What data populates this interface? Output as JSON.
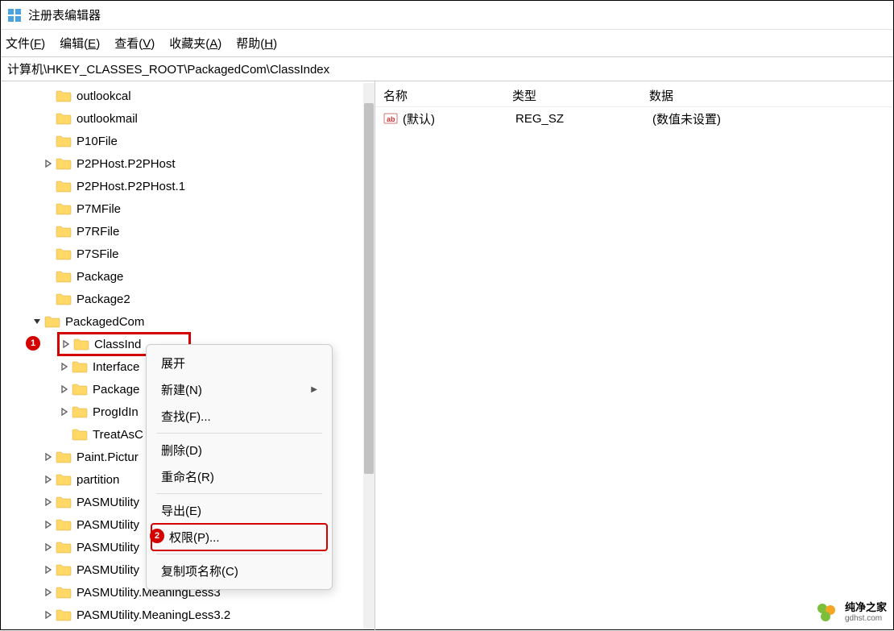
{
  "titlebar": {
    "title": "注册表编辑器"
  },
  "menubar": {
    "file": "文件(F)",
    "edit": "编辑(E)",
    "view": "查看(V)",
    "favorites": "收藏夹(A)",
    "help": "帮助(H)",
    "file_u": "F",
    "edit_u": "E",
    "view_u": "V",
    "fav_u": "A",
    "help_u": "H",
    "file_pre": "文件(",
    "edit_pre": "编辑(",
    "view_pre": "查看(",
    "fav_pre": "收藏夹(",
    "help_pre": "帮助(",
    "close": ")"
  },
  "address": "计算机\\HKEY_CLASSES_ROOT\\PackagedCom\\ClassIndex",
  "tree": {
    "items": [
      {
        "label": "outlookcal",
        "expander": "",
        "indent": 1
      },
      {
        "label": "outlookmail",
        "expander": "",
        "indent": 1
      },
      {
        "label": "P10File",
        "expander": "",
        "indent": 1
      },
      {
        "label": "P2PHost.P2PHost",
        "expander": "right",
        "indent": 1
      },
      {
        "label": "P2PHost.P2PHost.1",
        "expander": "",
        "indent": 1
      },
      {
        "label": "P7MFile",
        "expander": "",
        "indent": 1
      },
      {
        "label": "P7RFile",
        "expander": "",
        "indent": 1
      },
      {
        "label": "P7SFile",
        "expander": "",
        "indent": 1
      },
      {
        "label": "Package",
        "expander": "",
        "indent": 1
      },
      {
        "label": "Package2",
        "expander": "",
        "indent": 1
      },
      {
        "label": "PackagedCom",
        "expander": "down",
        "indent": 0
      },
      {
        "label": "ClassInd",
        "expander": "right",
        "indent": 2,
        "selected": true,
        "badge": "1"
      },
      {
        "label": "Interface",
        "expander": "right",
        "indent": 2
      },
      {
        "label": "Package",
        "expander": "right",
        "indent": 2
      },
      {
        "label": "ProgIdIn",
        "expander": "right",
        "indent": 2
      },
      {
        "label": "TreatAsC",
        "expander": "",
        "indent": 2
      },
      {
        "label": "Paint.Pictur",
        "expander": "right",
        "indent": 1
      },
      {
        "label": "partition",
        "expander": "right",
        "indent": 1
      },
      {
        "label": "PASMUtility",
        "expander": "right",
        "indent": 1
      },
      {
        "label": "PASMUtility",
        "expander": "right",
        "indent": 1
      },
      {
        "label": "PASMUtility",
        "expander": "right",
        "indent": 1
      },
      {
        "label": "PASMUtility",
        "expander": "right",
        "indent": 1
      },
      {
        "label": "PASMUtility.MeaningLess3",
        "expander": "right",
        "indent": 1
      },
      {
        "label": "PASMUtility.MeaningLess3.2",
        "expander": "right",
        "indent": 1
      }
    ]
  },
  "list": {
    "headers": {
      "name": "名称",
      "type": "类型",
      "data": "数据"
    },
    "rows": [
      {
        "name": "(默认)",
        "type": "REG_SZ",
        "data": "(数值未设置)"
      }
    ]
  },
  "context_menu": {
    "items": [
      {
        "label": "展开",
        "key": "expand"
      },
      {
        "label": "新建(N)",
        "key": "new",
        "submenu": true
      },
      {
        "label": "查找(F)...",
        "key": "find"
      },
      {
        "sep": true
      },
      {
        "label": "删除(D)",
        "key": "delete"
      },
      {
        "label": "重命名(R)",
        "key": "rename"
      },
      {
        "sep": true
      },
      {
        "label": "导出(E)",
        "key": "export"
      },
      {
        "label": "权限(P)...",
        "key": "permissions",
        "highlight": true,
        "badge": "2"
      },
      {
        "sep": true
      },
      {
        "label": "复制项名称(C)",
        "key": "copyname"
      }
    ]
  },
  "watermark": {
    "main": "纯净之家",
    "sub": "gdhst.com"
  }
}
